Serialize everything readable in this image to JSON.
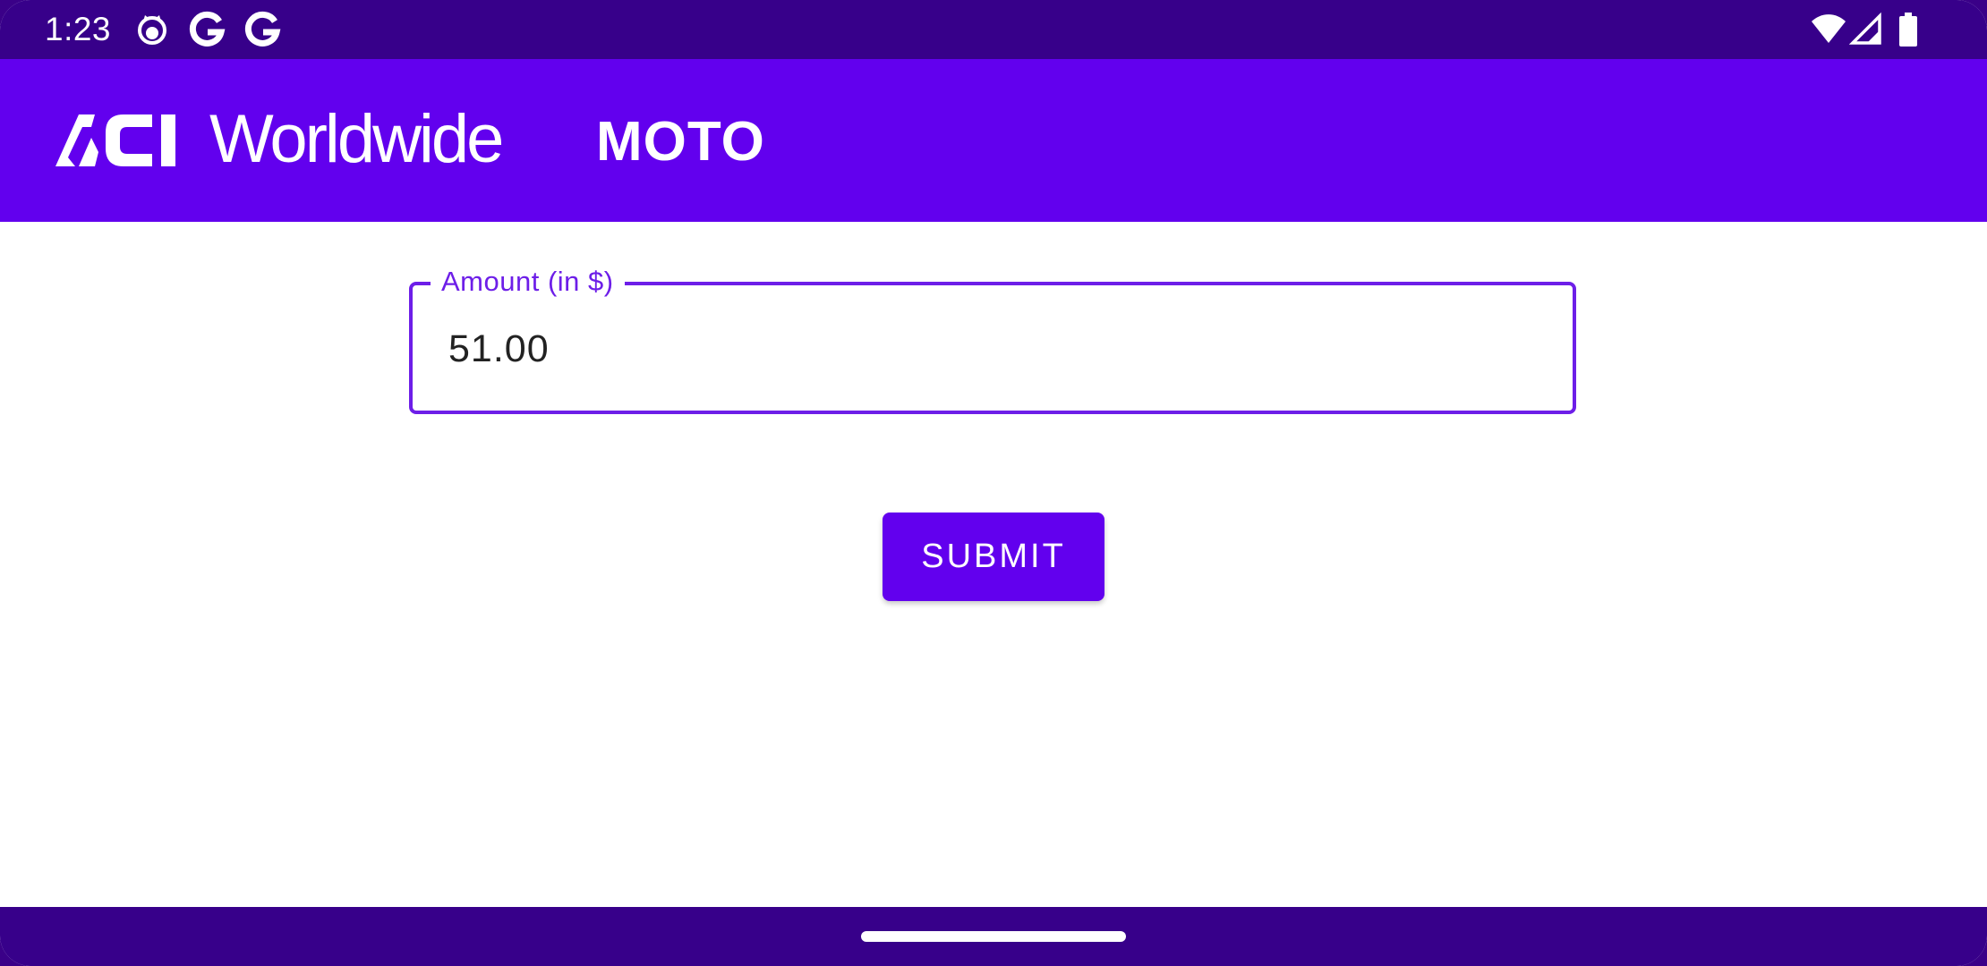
{
  "status_bar": {
    "time": "1:23",
    "left_icons": [
      "cat-face-icon",
      "google-g-icon",
      "google-g-icon"
    ],
    "right_icons": [
      "wifi-icon",
      "cell-signal-icon",
      "battery-icon"
    ]
  },
  "app_bar": {
    "logo_mark": "ACI",
    "logo_text": "Worldwide",
    "title": "MOTO"
  },
  "form": {
    "amount_label": "Amount (in $)",
    "amount_value": "51.00",
    "submit_label": "SUBMIT"
  },
  "nav_bar": {
    "handle": "home-gesture-handle"
  },
  "colors": {
    "status_bar": "#37008a",
    "app_bar": "#6200ee",
    "accent": "#6d1ee8",
    "button": "#6200ee"
  }
}
